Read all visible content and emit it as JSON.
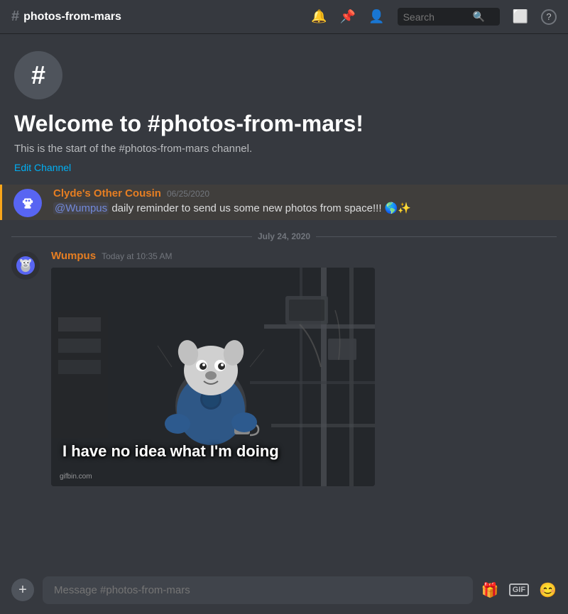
{
  "topbar": {
    "channel_hash": "#",
    "channel_name": "photos-from-mars",
    "search_placeholder": "Search",
    "icons": {
      "bell": "🔔",
      "pin": "📌",
      "people": "👤",
      "monitor": "🖥",
      "question": "?"
    }
  },
  "welcome": {
    "hash_symbol": "#",
    "title": "Welcome to #photos-from-mars!",
    "subtitle": "This is the start of the #photos-from-mars channel.",
    "edit_channel": "Edit Channel"
  },
  "messages": [
    {
      "id": "msg-clyde",
      "username": "Clyde's Other Cousin",
      "timestamp": "06/25/2020",
      "text_mention": "@Wumpus",
      "text_rest": " daily reminder to send us some new photos from space!!! 🌎✨",
      "avatar_type": "clyde"
    }
  ],
  "dividers": {
    "july": "July 24, 2020"
  },
  "wumpus_message": {
    "username": "Wumpus",
    "timestamp": "Today at 10:35 AM",
    "gif_text": "I have no idea what I'm doing",
    "gif_watermark": "gifbin.com"
  },
  "bottom_bar": {
    "input_placeholder": "Message #photos-from-mars",
    "add_label": "+",
    "gif_label": "GIF"
  }
}
